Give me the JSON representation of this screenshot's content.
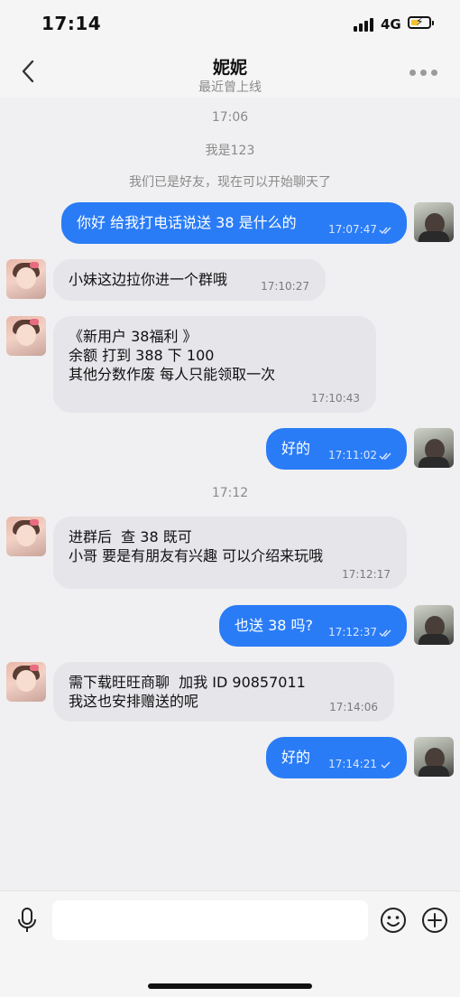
{
  "status_bar": {
    "time": "17:14",
    "network": "4G",
    "icons": [
      "signal-icon",
      "battery-charging-icon"
    ]
  },
  "header": {
    "title": "妮妮",
    "subtitle": "最近曾上线",
    "icons": [
      "back-chevron-icon",
      "more-dots-icon"
    ]
  },
  "chat": {
    "system_lines": [
      "17:06",
      "我是123",
      "我们已是好友，现在可以开始聊天了",
      "17:12"
    ],
    "messages": [
      {
        "dir": "out",
        "text": "你好 给我打电话说送 38 是什么的",
        "time": "17:07:47",
        "read": true
      },
      {
        "dir": "in",
        "text": "小妹这边拉你进一个群哦",
        "time": "17:10:27"
      },
      {
        "dir": "in",
        "text": "《新用户 38福利 》\n余额 打到 388 下 100\n其他分数作废 每人只能领取一次",
        "time": "17:10:43"
      },
      {
        "dir": "out",
        "text": "好的",
        "time": "17:11:02",
        "read": true
      },
      {
        "dir": "in",
        "text": "进群后  查 38 既可\n小哥 要是有朋友有兴趣 可以介绍来玩哦",
        "time": "17:12:17"
      },
      {
        "dir": "out",
        "text": "也送 38 吗?",
        "time": "17:12:37",
        "read": true
      },
      {
        "dir": "in",
        "text": "需下载旺旺商聊  加我 ID 90857011\n我这也安排赠送的呢",
        "time": "17:14:06"
      },
      {
        "dir": "out",
        "text": "好的",
        "time": "17:14:21",
        "read": false
      }
    ]
  },
  "input_bar": {
    "placeholder": "",
    "icons": [
      "microphone-icon",
      "emoji-icon",
      "plus-icon"
    ]
  },
  "colors": {
    "outgoing_bubble": "#2a7cf6",
    "incoming_bubble": "#e5e5ea",
    "background": "#f0f0f2"
  }
}
